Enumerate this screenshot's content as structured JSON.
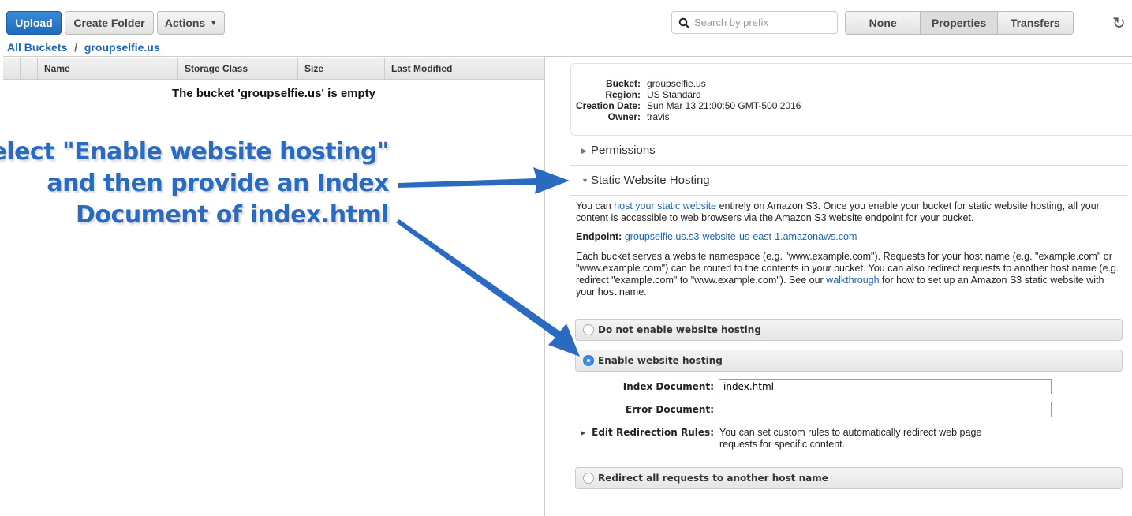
{
  "toolbar": {
    "upload": "Upload",
    "create_folder": "Create Folder",
    "actions": "Actions",
    "search_placeholder": "Search by prefix",
    "views": [
      "None",
      "Properties",
      "Transfers"
    ],
    "active_view": "Properties"
  },
  "breadcrumb": {
    "root": "All Buckets",
    "separator": "/",
    "bucket": "groupselfie.us"
  },
  "table": {
    "columns": [
      "Name",
      "Storage Class",
      "Size",
      "Last Modified"
    ],
    "empty_message": "The bucket 'groupselfie.us' is empty"
  },
  "properties": {
    "info": [
      {
        "label": "Bucket:",
        "value": "groupselfie.us"
      },
      {
        "label": "Region:",
        "value": "US Standard"
      },
      {
        "label": "Creation Date:",
        "value": "Sun Mar 13 21:00:50 GMT-500 2016"
      },
      {
        "label": "Owner:",
        "value": "travis"
      }
    ],
    "permissions": "Permissions",
    "static_hosting": "Static Website Hosting",
    "intro_pre": "You can ",
    "intro_link": "host your static website",
    "intro_post": " entirely on Amazon S3. Once you enable your bucket for static website hosting, all your content is accessible to web browsers via the Amazon S3 website endpoint for your bucket.",
    "endpoint_label": "Endpoint:",
    "endpoint": "groupselfie.us.s3-website-us-east-1.amazonaws.com",
    "ns_pre": "Each bucket serves a website namespace (e.g. \"www.example.com\"). Requests for your host name (e.g. \"example.com\" or \"www.example.com\") can be routed to the contents in your bucket. You can also redirect requests to another host name (e.g. redirect \"example.com\" to \"www.example.com\"). See our ",
    "ns_link": "walkthrough",
    "ns_post": " for how to set up an Amazon S3 static website with your host name.",
    "options": [
      "Do not enable website hosting",
      "Enable website hosting",
      "Redirect all requests to another host name"
    ],
    "selected_option": "Enable website hosting",
    "index_label": "Index Document:",
    "index_value": "index.html",
    "error_label": "Error Document:",
    "error_value": "",
    "redirect_label": "Edit Redirection Rules:",
    "redirect_text": "You can set custom rules to automatically redirect web page requests for specific content."
  },
  "annotation": {
    "lines": [
      "Select \"Enable website hosting\"",
      "and then provide an Index",
      "Document of index.html"
    ],
    "color": "#2a6bc0"
  }
}
